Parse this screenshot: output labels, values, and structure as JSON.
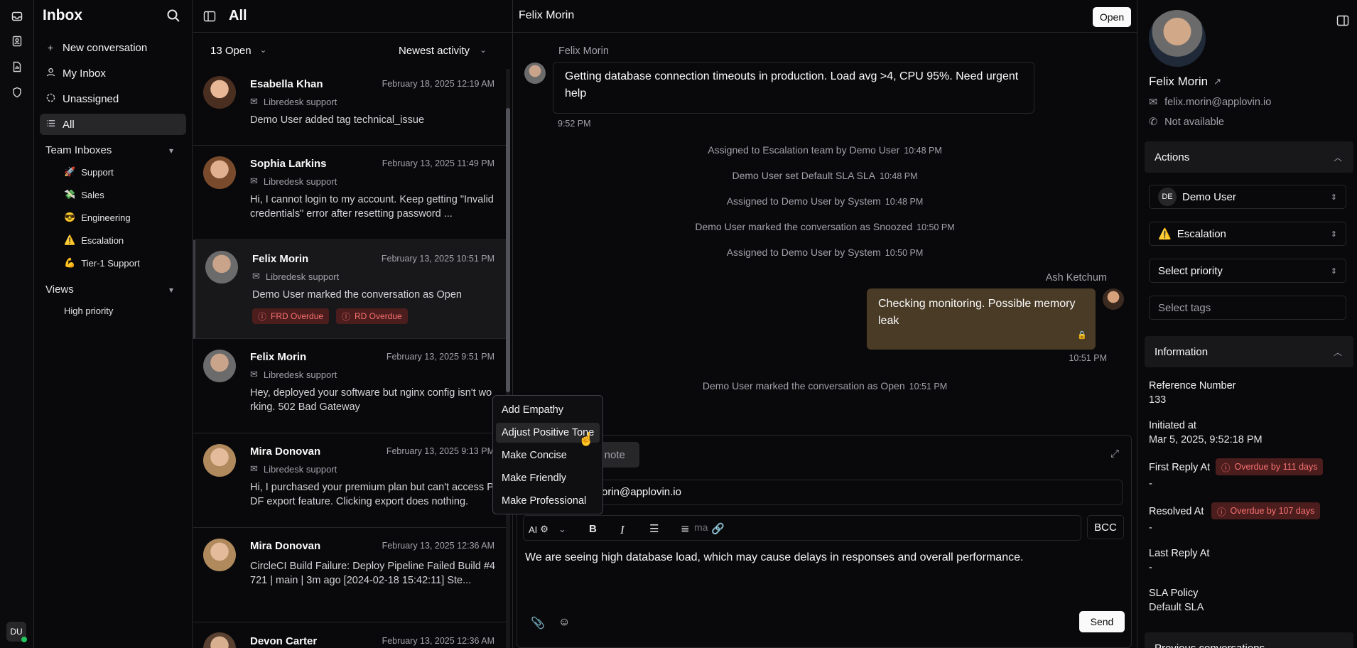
{
  "rail": {
    "user_initials": "DU"
  },
  "sidebar": {
    "title": "Inbox",
    "items": [
      {
        "label": "New conversation",
        "icon": "plus-icon"
      },
      {
        "label": "My Inbox",
        "icon": "user-icon"
      },
      {
        "label": "Unassigned",
        "icon": "dashed-circle-icon"
      },
      {
        "label": "All",
        "icon": "list-icon"
      }
    ],
    "team_inboxes_label": "Team Inboxes",
    "teams": [
      {
        "emoji": "🚀",
        "label": "Support"
      },
      {
        "emoji": "💸",
        "label": "Sales"
      },
      {
        "emoji": "😎",
        "label": "Engineering"
      },
      {
        "emoji": "⚠️",
        "label": "Escalation"
      },
      {
        "emoji": "💪",
        "label": "Tier-1 Support"
      }
    ],
    "views_label": "Views",
    "views": [
      {
        "label": "High priority"
      }
    ]
  },
  "list": {
    "title": "All",
    "status_filter": "13 Open",
    "sort": "Newest activity",
    "conversations": [
      {
        "name": "Esabella Khan",
        "date": "February 18, 2025 12:19 AM",
        "inbox": "Libredesk support",
        "preview": "Demo User added tag technical_issue"
      },
      {
        "name": "Sophia Larkins",
        "date": "February 13, 2025 11:49 PM",
        "inbox": "Libredesk support",
        "preview": "Hi, I cannot login to my account. Keep getting \"Invalid credentials\" error after resetting password ..."
      },
      {
        "name": "Felix Morin",
        "date": "February 13, 2025 10:51 PM",
        "inbox": "Libredesk support",
        "preview": "Demo User marked the conversation as Open",
        "badges": [
          "FRD Overdue",
          "RD Overdue"
        ]
      },
      {
        "name": "Felix Morin",
        "date": "February 13, 2025 9:51 PM",
        "inbox": "Libredesk support",
        "preview": "Hey, deployed your software but nginx config isn't working. 502 Bad Gateway"
      },
      {
        "name": "Mira Donovan",
        "date": "February 13, 2025 9:13 PM",
        "inbox": "Libredesk support",
        "preview": "Hi, I purchased your premium plan but can't access PDF export feature. Clicking export does nothing."
      },
      {
        "name": "Mira Donovan",
        "date": "February 13, 2025 12:36 AM",
        "inbox": "Libredesk support",
        "preview": "CircleCI Build Failure: Deploy Pipeline Failed Build #4721 | main | 3m ago [2024-02-18 15:42:11] Ste..."
      },
      {
        "name": "Devon Carter",
        "date": "February 13, 2025 12:36 AM",
        "inbox": "",
        "preview": ""
      }
    ]
  },
  "conversation": {
    "contact_name": "Felix Morin",
    "status_button": "Open",
    "first_message": {
      "sender": "Felix Morin",
      "text": "Getting database connection timeouts in production. Load avg >4, CPU 95%. Need urgent help",
      "time": "9:52 PM"
    },
    "activities": [
      {
        "text": "Assigned to Escalation team by Demo User",
        "time": "10:48 PM"
      },
      {
        "text": "Demo User set Default SLA SLA",
        "time": "10:48 PM"
      },
      {
        "text": "Assigned to Demo User by System",
        "time": "10:48 PM"
      },
      {
        "text": "Demo User marked the conversation as Snoozed",
        "time": "10:50 PM"
      },
      {
        "text": "Assigned to Demo User by System",
        "time": "10:50 PM"
      }
    ],
    "agent_message": {
      "sender": "Ash Ketchum",
      "text": "Checking monitoring. Possible memory leak",
      "time": "10:51 PM"
    },
    "last_activity": {
      "text": "Demo User marked the conversation as Open",
      "time": "10:51 PM"
    }
  },
  "editor": {
    "private_note_tab": "te note",
    "to_value": "orin@applovin.io",
    "cc_placeholder": "ma",
    "bcc_label": "BCC",
    "ai_label": "AI",
    "body": "We are seeing high database load, which may cause delays in responses and overall performance.",
    "send_label": "Send"
  },
  "ai_menu": {
    "items": [
      "Add Empathy",
      "Adjust Positive Tone",
      "Make Concise",
      "Make Friendly",
      "Make Professional"
    ],
    "highlighted_index": 1
  },
  "contact": {
    "name": "Felix Morin",
    "email": "felix.morin@applovin.io",
    "phone": "Not available"
  },
  "actions": {
    "title": "Actions",
    "assignee_initials": "DE",
    "assignee": "Demo User",
    "team_emoji": "⚠️",
    "team": "Escalation",
    "priority_placeholder": "Select priority",
    "tags_placeholder": "Select tags"
  },
  "information": {
    "title": "Information",
    "reference_label": "Reference Number",
    "reference_value": "133",
    "initiated_label": "Initiated at",
    "initiated_value": "Mar 5, 2025, 9:52:18 PM",
    "first_reply_label": "First Reply At",
    "first_reply_value": "-",
    "first_reply_badge": "Overdue by 111 days",
    "resolved_label": "Resolved At",
    "resolved_value": "-",
    "resolved_badge": "Overdue by 107 days",
    "last_reply_label": "Last Reply At",
    "last_reply_value": "-",
    "sla_label": "SLA Policy",
    "sla_value": "Default SLA",
    "previous_label": "Previous conversations"
  }
}
